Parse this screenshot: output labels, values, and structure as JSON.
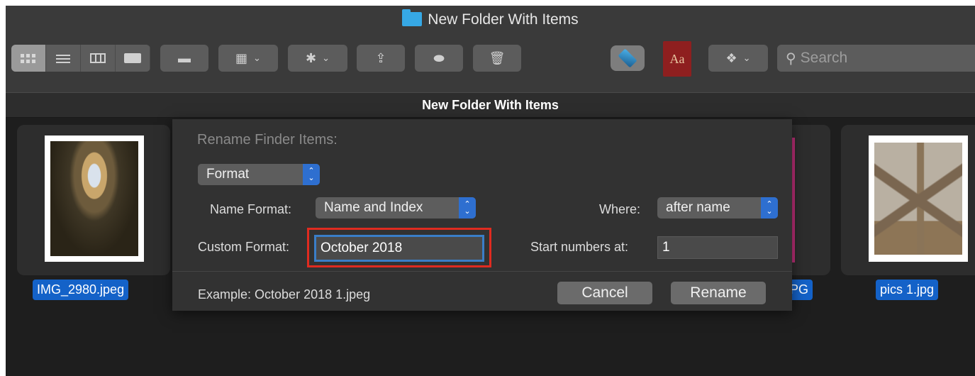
{
  "window": {
    "title": "New Folder With Items"
  },
  "toolbar": {
    "view_icons": [
      "icon-view-icon",
      "list-view-icon",
      "column-view-icon",
      "gallery-view-icon"
    ],
    "search_placeholder": "Search",
    "dictionary_label": "Aa"
  },
  "pathbar": {
    "title": "New Folder With Items"
  },
  "files": [
    {
      "name": "IMG_2980.jpeg"
    },
    {
      "name": "PG"
    },
    {
      "name": "pics 1.jpg"
    }
  ],
  "rename_dialog": {
    "title": "Rename Finder Items:",
    "mode": "Format",
    "name_format_label": "Name Format:",
    "name_format_value": "Name and Index",
    "where_label": "Where:",
    "where_value": "after name",
    "custom_format_label": "Custom Format:",
    "custom_format_value": "October 2018",
    "start_numbers_label": "Start numbers at:",
    "start_numbers_value": "1",
    "example": "Example: October 2018 1.jpeg",
    "cancel_label": "Cancel",
    "rename_label": "Rename"
  },
  "colors": {
    "accent": "#1462c8",
    "highlight_outline": "#e02b20",
    "window_bg": "#1e1e1e"
  }
}
